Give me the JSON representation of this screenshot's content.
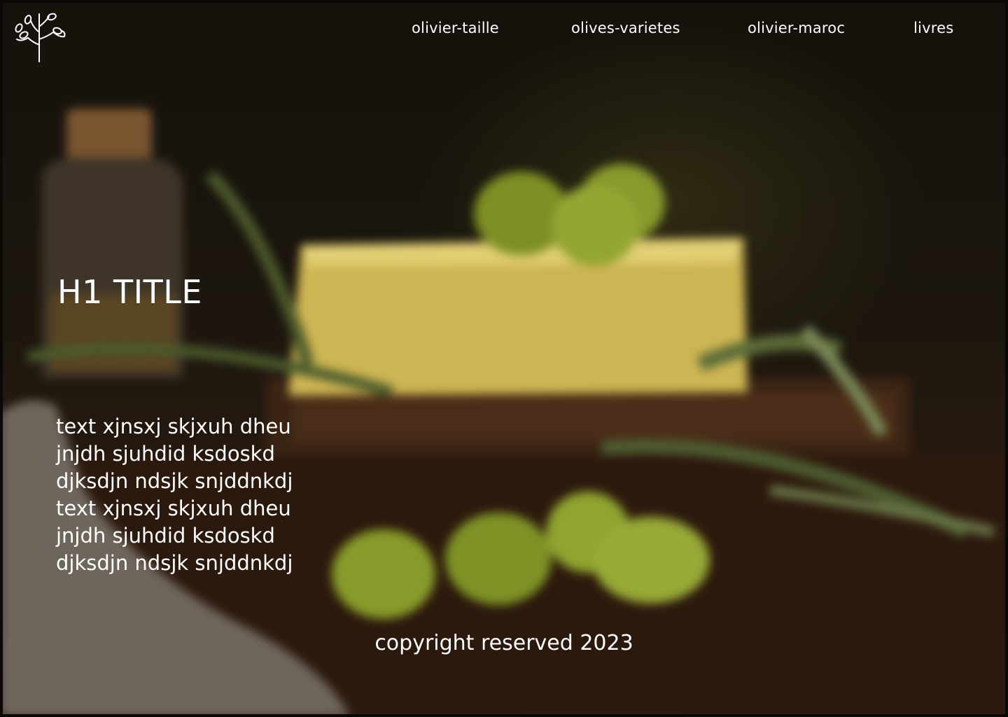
{
  "brand": {
    "logo_icon": "olive-branch-icon"
  },
  "nav": {
    "items": [
      {
        "label": "olivier-taille"
      },
      {
        "label": "olives-varietes"
      },
      {
        "label": "olivier-maroc"
      },
      {
        "label": "livres"
      }
    ]
  },
  "hero": {
    "title": "H1 TITLE",
    "body_lines": [
      "text xjnsxj skjxuh dheu",
      "jnjdh sjuhdid ksdoskd",
      "djksdjn ndsjk snjddnkdj",
      "text xjnsxj skjxuh dheu",
      "jnjdh sjuhdid ksdoskd",
      "djksdjn ndsjk snjddnkdj"
    ]
  },
  "footer": {
    "copyright": "copyright reserved 2023"
  },
  "colors": {
    "text": "#ffffff",
    "background_dark": "#1a130c",
    "olive_green": "#8a9a2a",
    "cheese_yellow": "#d8c25a"
  }
}
